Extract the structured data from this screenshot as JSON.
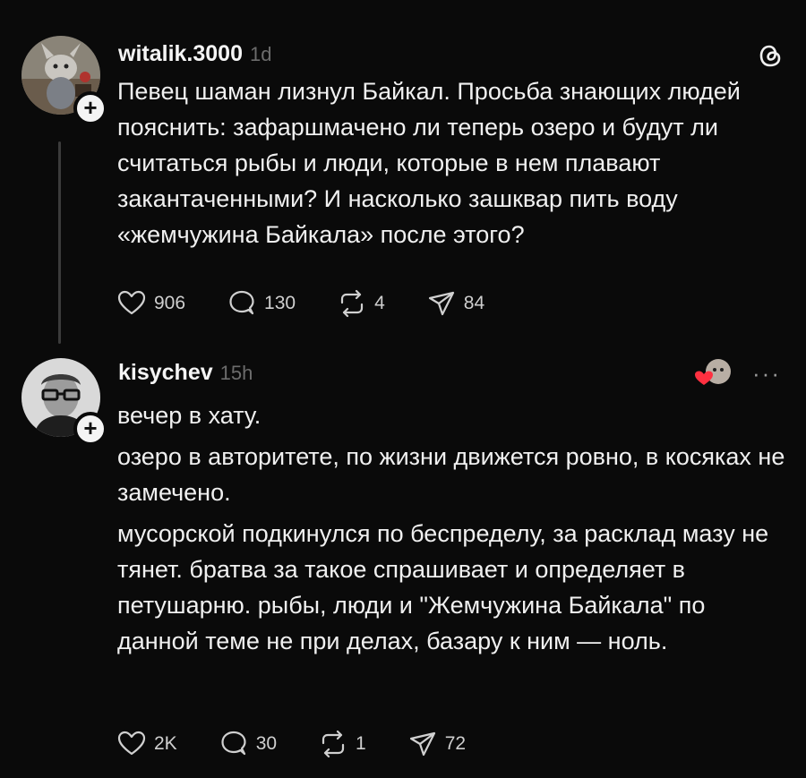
{
  "posts": [
    {
      "username": "witalik.3000",
      "time": "1d",
      "text": [
        "Певец шаман лизнул Байкал. Просьба знающих людей пояснить: зафаршмачено ли теперь озеро и будут ли считаться рыбы и люди, которые в нем плавают закантаченными? И насколько зашквар пить воду «жемчужина Байкала» после этого?"
      ],
      "likes": "906",
      "comments": "130",
      "reposts": "4",
      "shares": "84",
      "icons": {
        "corner": "threads-logo-icon",
        "avatar": "cartoon-cat-avatar"
      }
    },
    {
      "username": "kisychev",
      "time": "15h",
      "text": [
        "вечер в хату.",
        "озеро в авторитете, по жизни движется ровно, в косяках не замечено.",
        "мусорской подкинулся по беспределу, за расклад мазу не тянет. братва за такое спрашивает и определяет в петушарню. рыбы, люди и \"Жемчужина Байкала\" по данной теме не при делах, базару к ним — ноль."
      ],
      "likes": "2K",
      "comments": "30",
      "reposts": "1",
      "shares": "72",
      "icons": {
        "corner": "more-icon",
        "liked_by": "liked-by-author-avatar",
        "avatar": "man-glasses-avatar"
      }
    }
  ],
  "plus_label": "+",
  "colors": {
    "background": "#0a0a0a",
    "text": "#f0f0f0",
    "muted": "#6c6c6c",
    "heart": "#ff3040"
  }
}
